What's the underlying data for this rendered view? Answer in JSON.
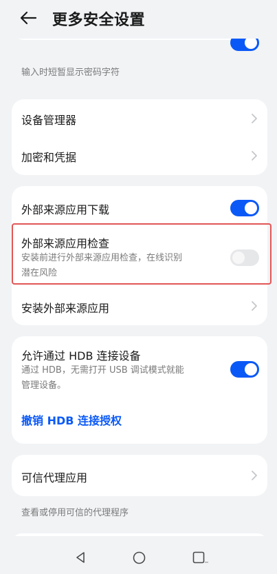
{
  "header": {
    "title": "更多安全设置"
  },
  "top": {
    "caption": "输入时短暂显示密码字符"
  },
  "card1": {
    "items": [
      {
        "label": "设备管理器"
      },
      {
        "label": "加密和凭据"
      }
    ]
  },
  "card2": {
    "external_download": {
      "label": "外部来源应用下载",
      "on": true
    },
    "external_check": {
      "label": "外部来源应用检查",
      "sub_line1": "安装前进行外部来源应用检查，在线识别",
      "sub_line2": "潜在风险",
      "on": false
    },
    "install_external": {
      "label": "安装外部来源应用"
    }
  },
  "card3": {
    "hdb": {
      "label": "允许通过 HDB 连接设备",
      "sub_line1": "通过 HDB，无需打开 USB 调试模式就能",
      "sub_line2": "管理设备。",
      "on": true
    },
    "revoke": {
      "label": "撤销 HDB 连接授权"
    }
  },
  "card4": {
    "trusted_agent": {
      "label": "可信代理应用"
    },
    "caption": "查看或停用可信的代理程序"
  },
  "colors": {
    "accent": "#0a59f7",
    "highlight": "#e25555",
    "background": "#f1f3f5"
  }
}
